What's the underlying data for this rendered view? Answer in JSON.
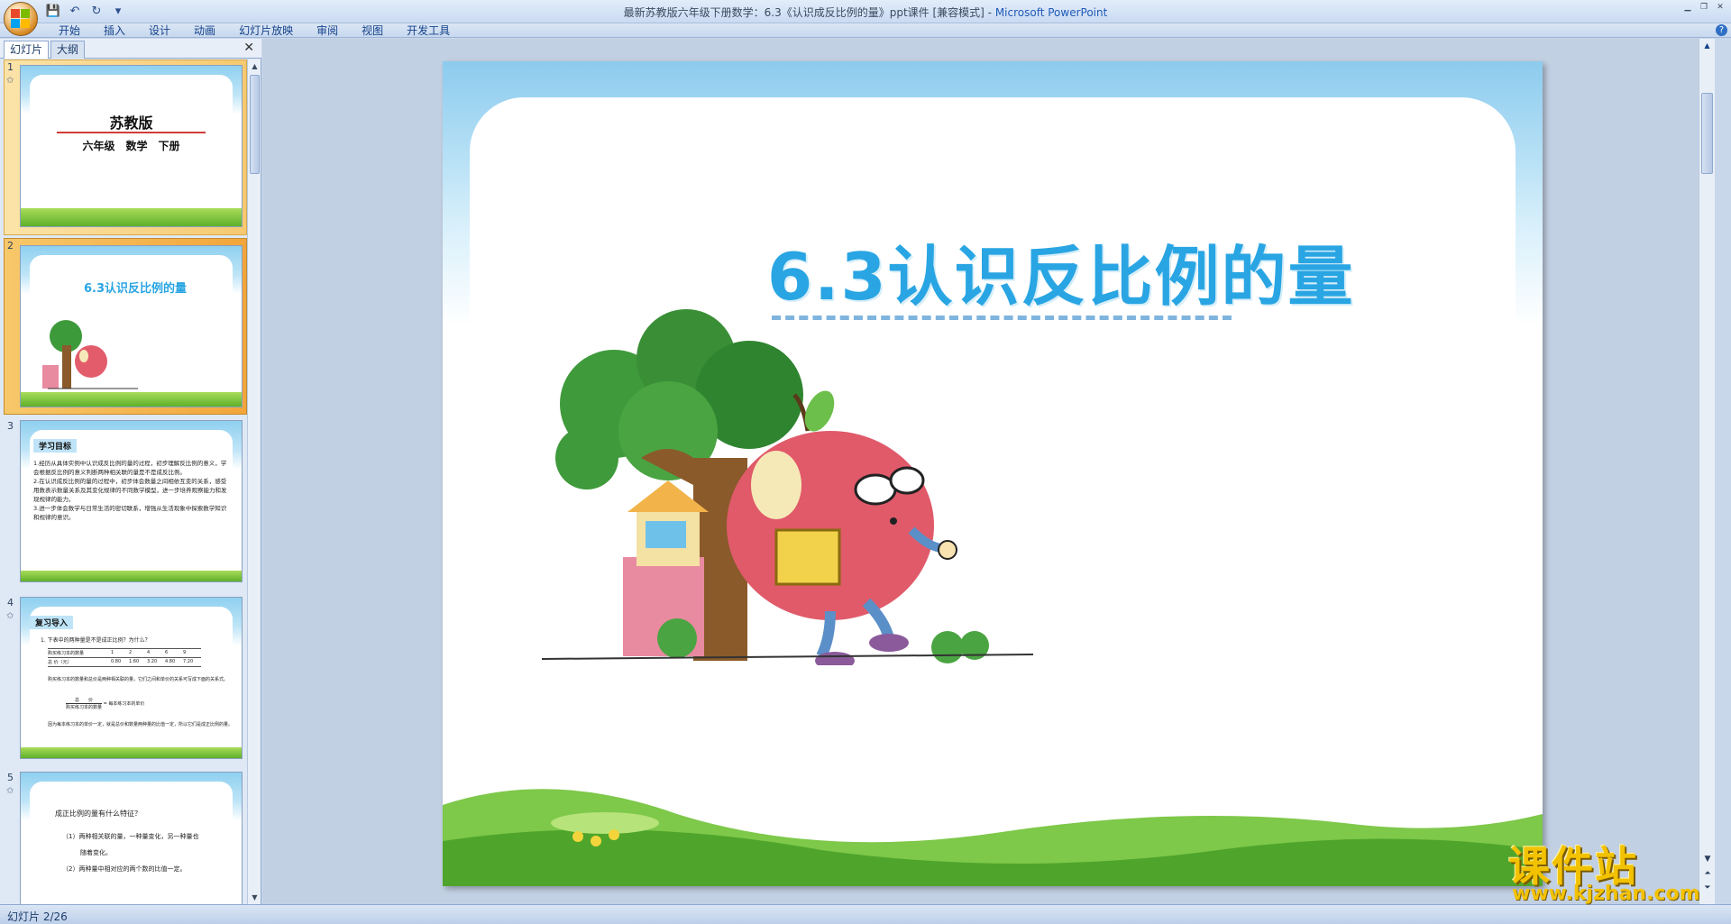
{
  "window": {
    "title": "最新苏教版六年级下册数学：6.3《认识成反比例的量》ppt课件 [兼容模式] - ",
    "app_name": "Microsoft PowerPoint"
  },
  "qat": {
    "save_icon": "💾",
    "undo_icon": "↶",
    "redo_icon": "↻",
    "more_icon": "▾"
  },
  "ribbon": {
    "tabs": [
      "开始",
      "插入",
      "设计",
      "动画",
      "幻灯片放映",
      "审阅",
      "视图",
      "开发工具"
    ],
    "help": "?"
  },
  "left_panel": {
    "tab_slides": "幻灯片",
    "tab_outline": "大纲",
    "close": "✕"
  },
  "thumbnails": [
    {
      "num": "1",
      "title": "苏教版",
      "subtitle": "六年级　数学　下册"
    },
    {
      "num": "2",
      "title": "6.3认识反比例的量"
    },
    {
      "num": "3",
      "heading": "学习目标",
      "lines": [
        "1.经历从具体实例中认识成反比例的量的过程，初步理解反比例的意义，学会根据反比例的意义判断两种相关联的量是不是成反比例。",
        "2.在认识成反比例的量的过程中，初步体会数量之间相依互变的关系，感受用数表示数量关系及其变化规律的不同数学模型，进一步培养观察能力和发现规律的能力。",
        "3.进一步体会数学与日常生活的密切联系，增强从生活现象中探索数学知识和规律的意识。"
      ]
    },
    {
      "num": "4",
      "heading": "复习导入",
      "question": "1. 下表中的两种量是不是成正比例？为什么？",
      "table": {
        "rows": [
          [
            "购买练习本的数量",
            "1",
            "2",
            "4",
            "6",
            "9"
          ],
          [
            "总 价（元）",
            "0.80",
            "1.60",
            "3.20",
            "4.80",
            "7.20"
          ]
        ]
      },
      "note1": "购买练习本的数量和总价是两种相关联的量，它们之间和单价的关系可写成下面的关系式。",
      "formula_top": "总　　价",
      "formula_bottom": "购买练习本的数量",
      "formula_right": "= 每本练习本的单价",
      "note2": "因为每本练习本的单价一定，就是总价和数量两种量的比值一定，所以它们是成正比例的量。"
    },
    {
      "num": "5",
      "question": "成正比例的量有什么特征？",
      "points": [
        "（1）两种相关联的量，一种量变化，另一种量也",
        "随着变化。",
        "（2）两种量中相对应的两个数的比值一定。"
      ]
    }
  ],
  "slide": {
    "title": "6.3认识反比例的量"
  },
  "status": {
    "text": "幻灯片 2/26"
  },
  "watermark": {
    "title": "课件站",
    "url": "www.kjzhan.com"
  }
}
